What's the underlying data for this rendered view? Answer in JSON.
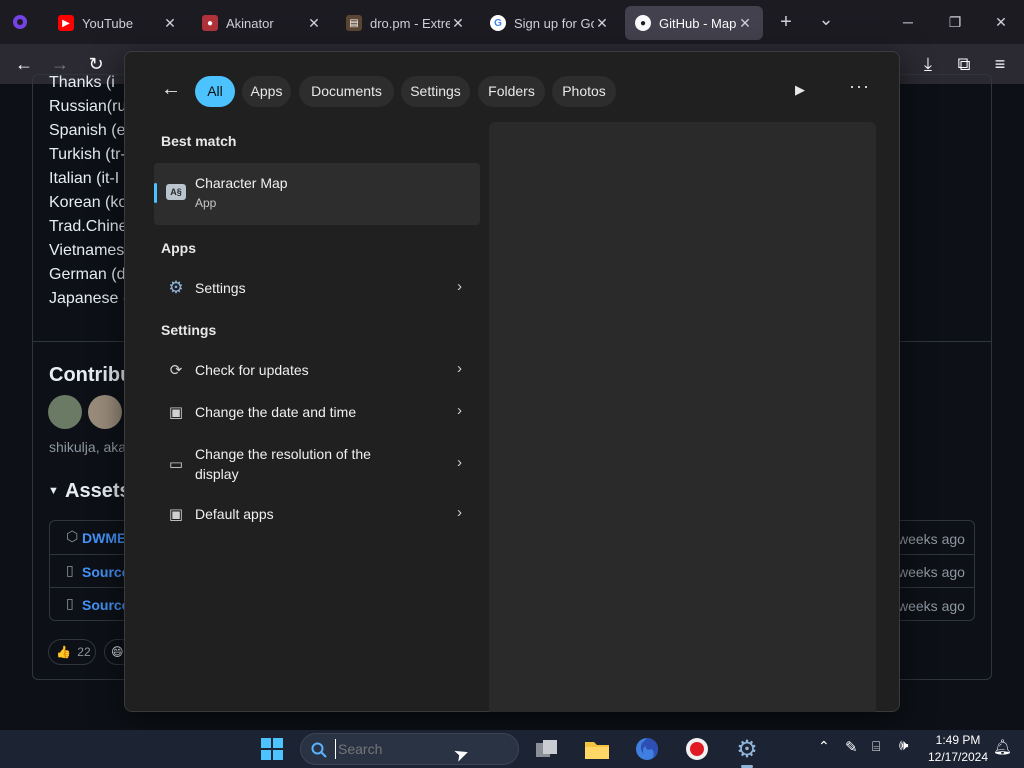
{
  "browser": {
    "tabs": [
      {
        "title": "YouTube",
        "icon": "youtube-icon",
        "color": "#ff0000"
      },
      {
        "title": "Akinator",
        "icon": "akinator-icon",
        "color": "#b0323a"
      },
      {
        "title": "dro.pm - Extrem",
        "icon": "dropm-icon",
        "color": "#5a4632"
      },
      {
        "title": "Sign up for Goo",
        "icon": "google-icon",
        "color": "#4285f4"
      },
      {
        "title": "GitHub - Maple",
        "icon": "github-icon",
        "color": "#ffffff"
      }
    ],
    "new_tab": "+",
    "tab_list": "⌄"
  },
  "page": {
    "languages": [
      "Thanks (i",
      "Russian(ru-",
      "Spanish (es",
      "Turkish (tr-",
      "Italian (it-I",
      "Korean (ko",
      "Trad.Chines",
      "Vietnames",
      "German (d",
      "Japanese (j"
    ],
    "contributors_heading": "Contribu",
    "contributors_names": "shikulja, akay",
    "assets_heading": "Assets",
    "assets": [
      {
        "name": "DWME",
        "date": "weeks ago"
      },
      {
        "name": "Source",
        "date": "weeks ago"
      },
      {
        "name": "Source",
        "date": "weeks ago"
      }
    ],
    "reactions": [
      {
        "emoji": "👍",
        "count": "22"
      },
      {
        "emoji": "😄",
        "count": ""
      }
    ]
  },
  "start_menu": {
    "filters": [
      "All",
      "Apps",
      "Documents",
      "Settings",
      "Folders",
      "Photos"
    ],
    "best_match_heading": "Best match",
    "best_match": {
      "title": "Character Map",
      "subtitle": "App"
    },
    "apps_heading": "Apps",
    "apps": [
      {
        "label": "Settings"
      }
    ],
    "settings_heading": "Settings",
    "settings": [
      {
        "label": "Check for updates",
        "icon": "refresh-icon"
      },
      {
        "label": "Change the date and time",
        "icon": "calendar-clock-icon"
      },
      {
        "label": "Change the resolution of the display",
        "icon": "laptop-icon"
      },
      {
        "label": "Default apps",
        "icon": "default-apps-icon"
      }
    ],
    "accent": "#4cc2ff"
  },
  "taskbar": {
    "search_placeholder": "Search",
    "time": "1:49 PM",
    "date": "12/17/2024"
  }
}
